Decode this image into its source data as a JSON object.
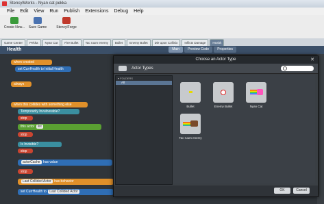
{
  "window": {
    "title": "StencylWorks - Nyan cat pekka"
  },
  "menu": [
    "File",
    "Edit",
    "View",
    "Run",
    "Publish",
    "Extensions",
    "Debug",
    "Help"
  ],
  "toolbar": {
    "create_label": "Create New...",
    "save_label": "Save Game",
    "forge_label": "StencylForge"
  },
  "doc_tabs": [
    "Game Center",
    "Pekka",
    "Nyan Cat",
    "Fire Bullet",
    "Tac ruum enemy",
    "Bullet",
    "Enemy Bullet",
    "Die upon Collisio",
    "Inflicts Damage",
    "Health"
  ],
  "header": {
    "title": "Health",
    "tabs": [
      "Main",
      "Preview Code",
      "Properties"
    ]
  },
  "blocks": {
    "when_created": "when created",
    "set_health": "set CurrHealth to Initial Health",
    "always": "always",
    "when_collides": "when this collides with something else",
    "temporarily_invulnerable": "Temporarily Invulnerable?",
    "stop": "stop",
    "this_actor": "this actor",
    "is_invisible": "Is Invisible?",
    "has_value": "has value",
    "collided_actor": "Last Collided Actor",
    "has_behavior": "has behavior",
    "set_text": "set CurrHealth to"
  },
  "dialog": {
    "title": "Choose an Actor Type",
    "section": "Actor Types",
    "folders_label": "FOLDERS",
    "folder_selected": "All",
    "actors": [
      {
        "name": "Bullet"
      },
      {
        "name": "Enemy Bullet"
      },
      {
        "name": "Nyan Cat"
      },
      {
        "name": "Tac ruum enemy"
      }
    ],
    "ok_label": "OK",
    "cancel_label": "Cancel"
  }
}
